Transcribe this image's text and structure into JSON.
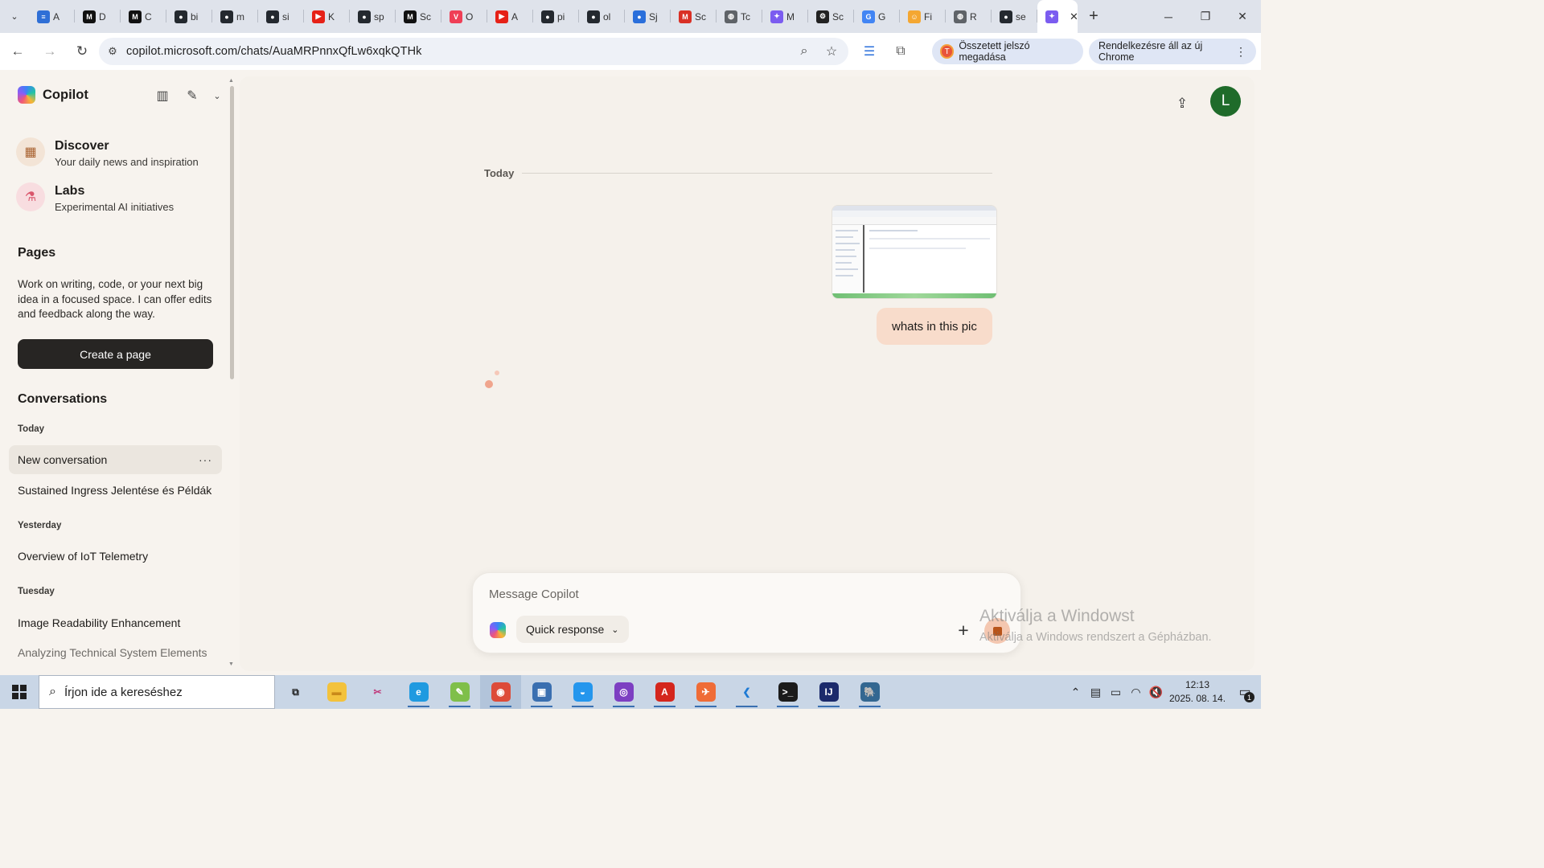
{
  "browser": {
    "tabs": [
      {
        "label": "A",
        "icon": "azure-devops-icon",
        "color": "#2f6fd6",
        "glyph": "≡"
      },
      {
        "label": "D",
        "icon": "medium-icon",
        "color": "#111111",
        "glyph": "M"
      },
      {
        "label": "C",
        "icon": "medium-icon",
        "color": "#111111",
        "glyph": "M"
      },
      {
        "label": "bi",
        "icon": "github-icon",
        "color": "#24292f",
        "glyph": "●"
      },
      {
        "label": "m",
        "icon": "github-icon",
        "color": "#24292f",
        "glyph": "●"
      },
      {
        "label": "si",
        "icon": "github-icon",
        "color": "#24292f",
        "glyph": "●"
      },
      {
        "label": "K",
        "icon": "youtube-icon",
        "color": "#e62117",
        "glyph": "▶"
      },
      {
        "label": "sp",
        "icon": "github-icon",
        "color": "#24292f",
        "glyph": "●"
      },
      {
        "label": "Sc",
        "icon": "medium-icon",
        "color": "#111111",
        "glyph": "M"
      },
      {
        "label": "O",
        "icon": "pocket-icon",
        "color": "#ef3f56",
        "glyph": "V"
      },
      {
        "label": "A",
        "icon": "youtube-icon",
        "color": "#e62117",
        "glyph": "▶"
      },
      {
        "label": "pi",
        "icon": "github-icon",
        "color": "#24292f",
        "glyph": "●"
      },
      {
        "label": "ol",
        "icon": "github-icon",
        "color": "#24292f",
        "glyph": "●"
      },
      {
        "label": "Sj",
        "icon": "signal-icon",
        "color": "#2a6fdb",
        "glyph": "●"
      },
      {
        "label": "Sc",
        "icon": "gmail-icon",
        "color": "#d93025",
        "glyph": "M"
      },
      {
        "label": "Tc",
        "icon": "globe-icon",
        "color": "#5f6368",
        "glyph": "◍"
      },
      {
        "label": "M",
        "icon": "copilot-icon",
        "color": "#7b5cf0",
        "glyph": "✦"
      },
      {
        "label": "Sc",
        "icon": "openai-icon",
        "color": "#222222",
        "glyph": "⚙"
      },
      {
        "label": "G",
        "icon": "google-translate-icon",
        "color": "#4285f4",
        "glyph": "G"
      },
      {
        "label": "Fi",
        "icon": "emoji-icon",
        "color": "#f4a732",
        "glyph": "☺"
      },
      {
        "label": "R",
        "icon": "globe-icon",
        "color": "#5f6368",
        "glyph": "◍"
      },
      {
        "label": "se",
        "icon": "github-icon",
        "color": "#24292f",
        "glyph": "●"
      }
    ],
    "active_tab": {
      "label": "M",
      "icon": "copilot-icon",
      "color": "#7b5cf0",
      "glyph": "✦"
    },
    "url": "copilot.microsoft.com/chats/AuaMRPnnxQfLw6xqkQTHk",
    "password_chip": "Összetett jelszó megadása",
    "password_chip_badge": "T",
    "update_chip": "Rendelkezésre áll az új Chrome"
  },
  "sidebar": {
    "app_name": "Copilot",
    "features": [
      {
        "title": "Discover",
        "subtitle": "Your daily news and inspiration",
        "icon": "grid-icon",
        "bg": "#f3e4d6"
      },
      {
        "title": "Labs",
        "subtitle": "Experimental AI initiatives",
        "icon": "flask-icon",
        "bg": "#f8dde0"
      }
    ],
    "pages_title": "Pages",
    "pages_desc": "Work on writing, code, or your next big idea in a focused space. I can offer edits and feedback along the way.",
    "create_page_label": "Create a page",
    "conversations_title": "Conversations",
    "groups": [
      {
        "label": "Today",
        "items": [
          "New conversation",
          "Sustained Ingress Jelentése és Példák"
        ]
      },
      {
        "label": "Yesterday",
        "items": [
          "Overview of IoT Telemetry"
        ]
      },
      {
        "label": "Tuesday",
        "items": [
          "Image Readability Enhancement",
          "Analyzing Technical System Elements"
        ]
      }
    ]
  },
  "chat": {
    "day_label": "Today",
    "user_message": "whats in this pic",
    "avatar_initial": "L"
  },
  "composer": {
    "placeholder": "Message Copilot",
    "mode_label": "Quick response"
  },
  "watermark": {
    "line1": "Aktiválja a Windowst",
    "line2": "Aktiválja a Windows rendszert a Gépházban."
  },
  "taskbar": {
    "search_placeholder": "Írjon ide a kereséshez",
    "apps": [
      {
        "name": "task-view-icon",
        "color": "transparent",
        "glyph": "⧉",
        "fg": "#1f1f1f"
      },
      {
        "name": "file-explorer-icon",
        "color": "#f3c23c",
        "glyph": "▬",
        "fg": "#c9891a"
      },
      {
        "name": "snipping-tool-icon",
        "color": "transparent",
        "glyph": "✂",
        "fg": "#c0397b"
      },
      {
        "name": "edge-icon",
        "color": "#1f9ae0",
        "glyph": "e",
        "fg": "#ffffff"
      },
      {
        "name": "notepad-plus-plus-icon",
        "color": "#7fbf4a",
        "glyph": "✎",
        "fg": "#ffffff"
      },
      {
        "name": "chrome-icon",
        "color": "#dd4b39",
        "glyph": "◉",
        "fg": "#ffffff"
      },
      {
        "name": "save-icon",
        "color": "#3a6fb0",
        "glyph": "▣",
        "fg": "#ffffff"
      },
      {
        "name": "docker-icon",
        "color": "#2496ed",
        "glyph": "◒",
        "fg": "#ffffff"
      },
      {
        "name": "tor-browser-icon",
        "color": "#7d3fc2",
        "glyph": "◎",
        "fg": "#ffffff"
      },
      {
        "name": "acrobat-icon",
        "color": "#d4261d",
        "glyph": "A",
        "fg": "#ffffff"
      },
      {
        "name": "postman-icon",
        "color": "#ef6c37",
        "glyph": "✈",
        "fg": "#ffffff"
      },
      {
        "name": "vscode-icon",
        "color": "transparent",
        "glyph": "❮",
        "fg": "#1e7ad4"
      },
      {
        "name": "terminal-icon",
        "color": "#1b1b1b",
        "glyph": ">_",
        "fg": "#ffffff"
      },
      {
        "name": "intellij-icon",
        "color": "#1b2a6b",
        "glyph": "IJ",
        "fg": "#ffffff"
      },
      {
        "name": "postgres-icon",
        "color": "#336791",
        "glyph": "🐘",
        "fg": "#ffffff"
      }
    ],
    "time": "12:13",
    "date": "2025. 08. 14.",
    "notification_count": "1"
  }
}
